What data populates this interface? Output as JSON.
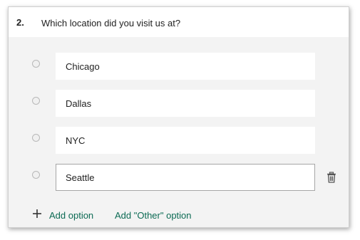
{
  "question": {
    "number": "2.",
    "text": "Which location did you visit us at?"
  },
  "options": [
    {
      "label": "Chicago"
    },
    {
      "label": "Dallas"
    },
    {
      "label": "NYC"
    },
    {
      "label": "Seattle",
      "active": true
    }
  ],
  "actions": {
    "add_option_label": "Add option",
    "add_other_label": "Add \"Other\" option"
  },
  "icons": {
    "delete": "trash-icon",
    "add": "plus-icon",
    "radio": "radio-icon"
  },
  "colors": {
    "link": "#0b6a53",
    "card_background": "#f3f3f3"
  }
}
